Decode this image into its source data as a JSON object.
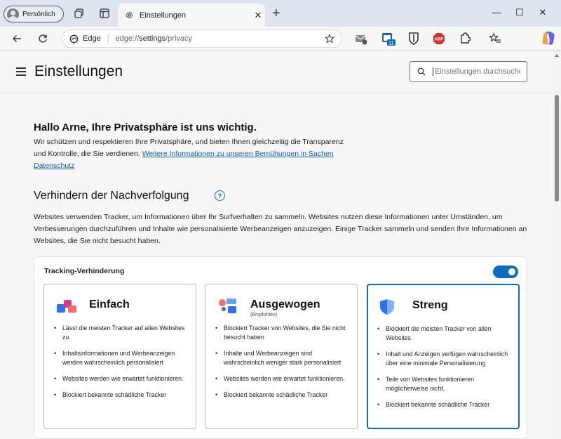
{
  "browser": {
    "profile_label": "Persönlich",
    "tab_title": "Einstellungen",
    "tab_close": "✕",
    "new_tab": "+",
    "window_minimize": "—",
    "window_maximize": "☐",
    "window_close": "✕",
    "url_site": "Edge",
    "url_prefix": "edge://",
    "url_host": "settings",
    "url_path": "/privacy",
    "extensions": [
      "mail-icon",
      "calendar-badge-icon",
      "bitwarden-icon",
      "adblock-icon",
      "puzzle-icon",
      "favorites-icon",
      "copilot-icon"
    ],
    "extension_badge": "11",
    "adblock_label": "ABP"
  },
  "settings": {
    "title": "Einstellungen",
    "search_placeholder": "Einstellungen durchsuchen"
  },
  "privacy": {
    "greeting": "Hallo Arne, Ihre Privatsphäre ist uns wichtig.",
    "intro_text": "Wir schützen und respektieren Ihre Privatsphäre, und bieten Ihnen gleichzeitig die Transparenz und Kontrolle, die Sie verdienen. ",
    "intro_link": "Weitere Informationen zu unseren Bemühungen in Sachen Datenschutz",
    "section_title": "Verhindern der Nachverfolgung",
    "help_label": "?",
    "section_description": "Websites verwenden Tracker, um Informationen über Ihr Surfverhalten zu sammeln. Websites nutzen diese Informationen unter Umständen, um Verbesserungen durchzuführen und Inhalte wie personalisierte Werbeanzeigen anzuzeigen. Einige Tracker sammeln und senden Ihre Informationen an Websites, die Sie nicht besucht haben.",
    "tracking_label": "Tracking-Verhinderung",
    "tracking_enabled": true,
    "accent_color": "#0f6cbd",
    "levels": [
      {
        "title": "Einfach",
        "subtitle": "",
        "selected": false,
        "bullets": [
          "Lässt die meisten Tracker auf allen Websites zu",
          "Inhaltsinformationen und Werbeanzeigen werden wahrscheinlich personalisiert",
          "Websites werden wie erwartet funktionieren.",
          "Blockiert bekannte schädliche Tracker"
        ]
      },
      {
        "title": "Ausgewogen",
        "subtitle": "(Empfohlen)",
        "selected": false,
        "bullets": [
          "Blockiert Tracker von Websites, die Sie nicht besucht haben",
          "Inhalte und Werbeanzeigen sind wahrscheinlich weniger stark personalisiert",
          "Websites werden wie erwartet funktionieren.",
          "Blockiert bekannte schädliche Tracker"
        ]
      },
      {
        "title": "Streng",
        "subtitle": "",
        "selected": true,
        "bullets": [
          "Blockiert die meisten Tracker von allen Websites",
          "Inhalt und Anzeigen verfügen wahrscheinlich über eine minimale Personalisierung",
          "Teile von Websites funktionieren möglicherweise nicht.",
          "Blockiert bekannte schädliche Tracker"
        ]
      }
    ]
  }
}
